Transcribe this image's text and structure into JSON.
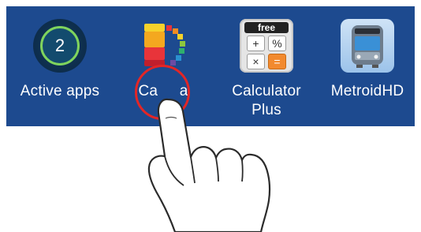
{
  "apps": [
    {
      "label": "Active apps",
      "badge_count": "2",
      "icon": "active-apps-icon"
    },
    {
      "label": "Ca",
      "label_tail": "a",
      "icon": "colorful-blocks-icon"
    },
    {
      "label_line1": "Calculator",
      "label_line2": "Plus",
      "icon": "calculator-icon",
      "calc": {
        "free": "free",
        "plus": "+",
        "percent": "%",
        "times": "×",
        "equals": "="
      }
    },
    {
      "label": "MetroidHD",
      "icon": "train-icon"
    }
  ],
  "colors": {
    "app_bar": "#1d4a8f",
    "tap_ring": "#e32626",
    "active_ring": "#7fd45d",
    "calc_equals": "#f28a2f"
  }
}
